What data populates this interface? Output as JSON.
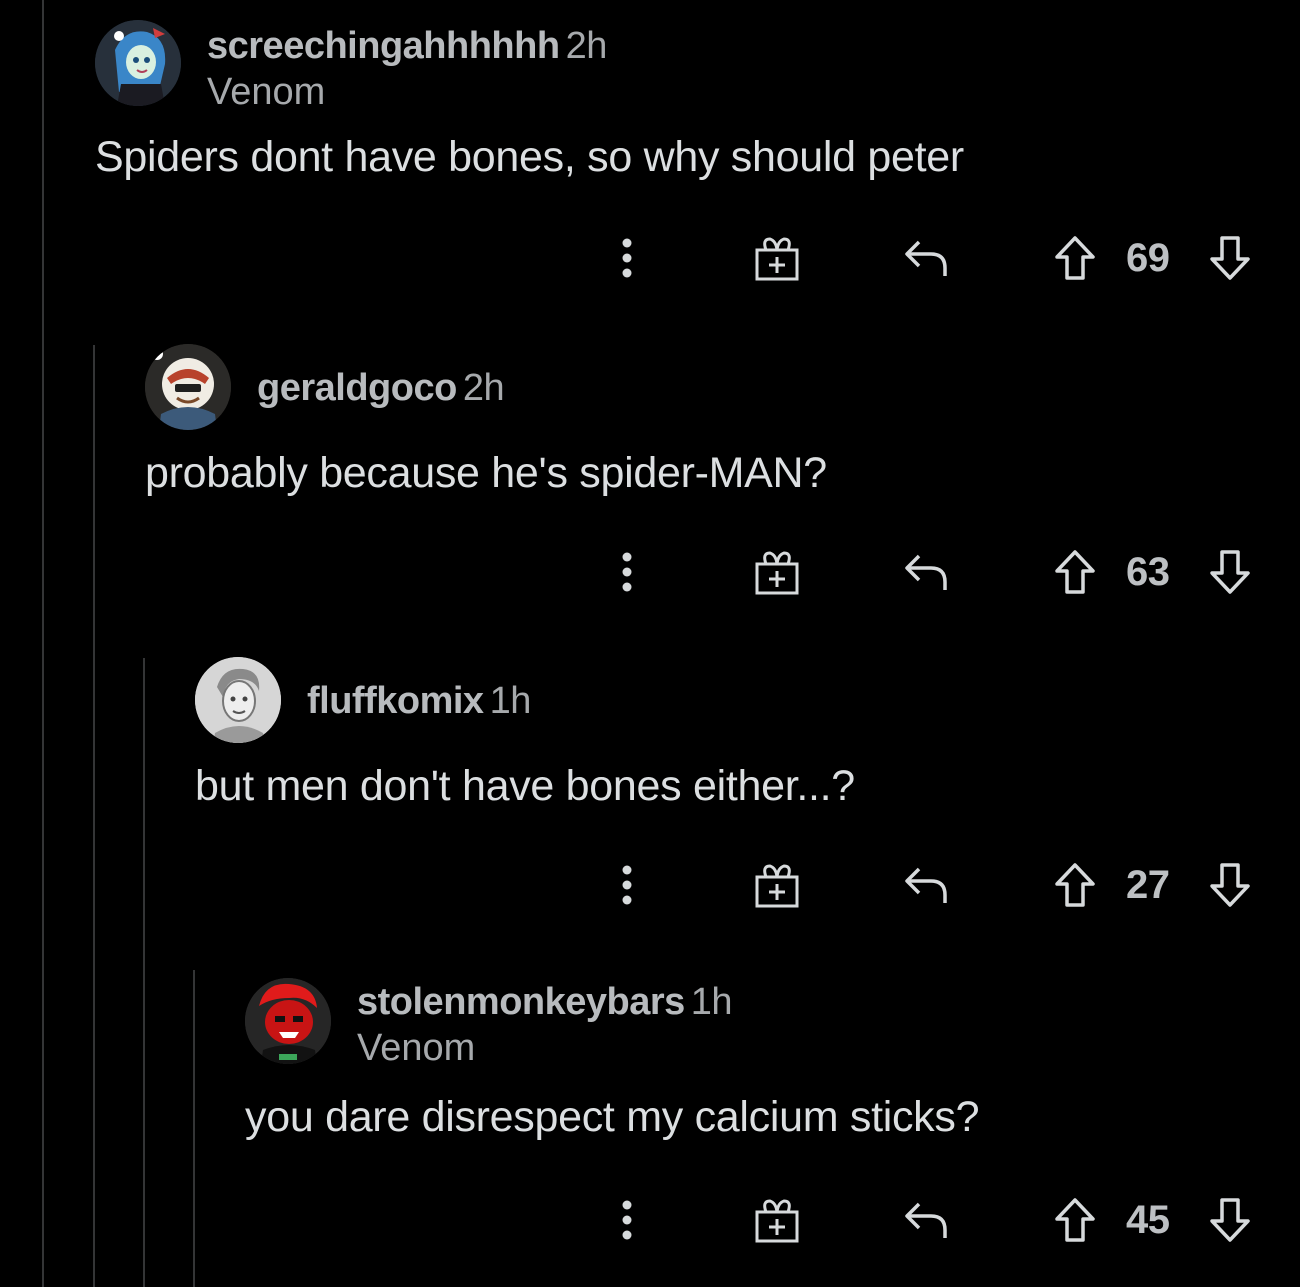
{
  "comments": [
    {
      "username": "screechingahhhhhh",
      "time": "2h",
      "flair": "Venom",
      "body": "Spiders dont have bones, so why should peter",
      "score": "69"
    },
    {
      "username": "geraldgoco",
      "time": "2h",
      "flair": "",
      "body": "probably because he's spider-MAN?",
      "score": "63"
    },
    {
      "username": "fluffkomix",
      "time": "1h",
      "flair": "",
      "body": "but men don't have bones either...?",
      "score": "27"
    },
    {
      "username": "stolenmonkeybars",
      "time": "1h",
      "flair": "Venom",
      "body": "you dare disrespect my calcium sticks?",
      "score": "45"
    }
  ],
  "icons": {
    "more": "more-vertical-icon",
    "award": "gift-award-icon",
    "reply": "reply-arrow-icon",
    "upvote": "upvote-arrow-icon",
    "downvote": "downvote-arrow-icon"
  },
  "colors": {
    "background": "#000000",
    "text": "#dcdfe1",
    "muted": "#a6a9ac",
    "thread_line": "#343536"
  }
}
